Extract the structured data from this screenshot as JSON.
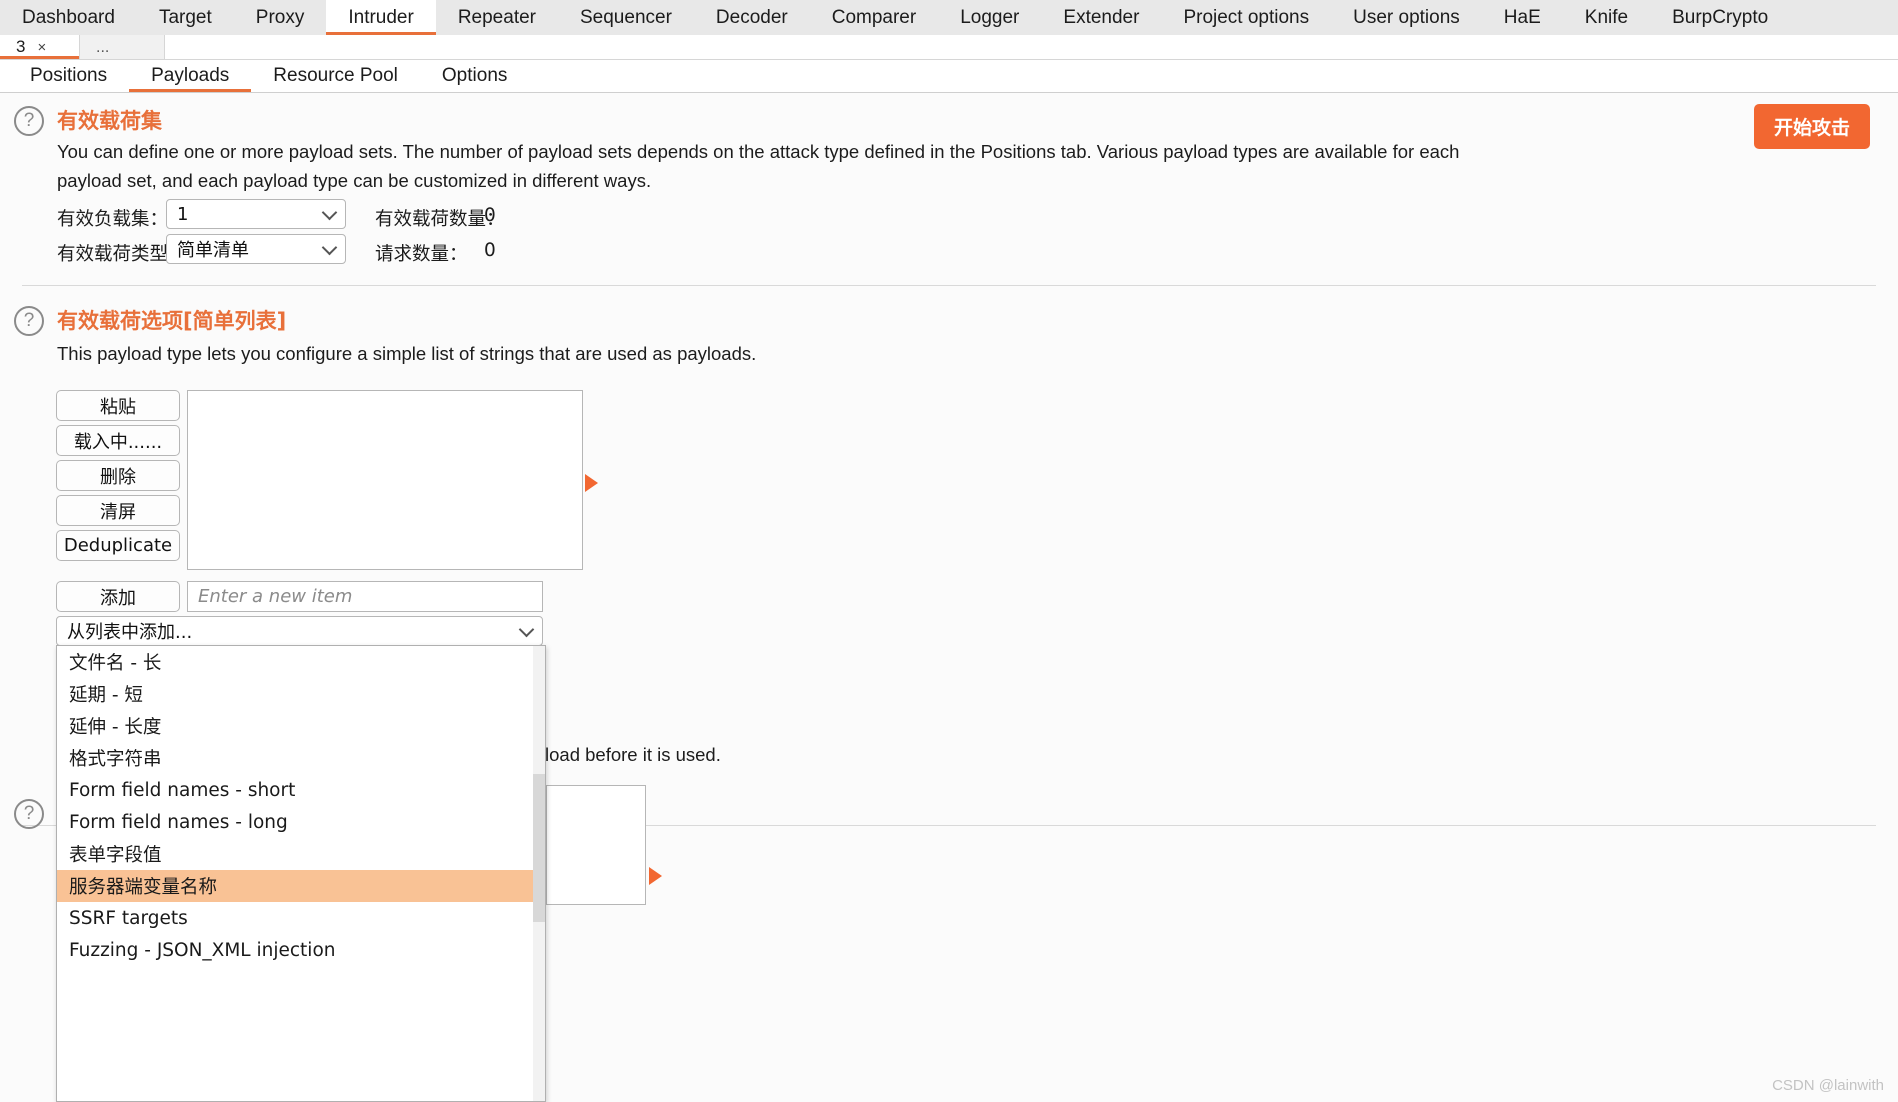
{
  "window": {
    "top_tabs": [
      {
        "label": "Dashboard",
        "active": false
      },
      {
        "label": "Target",
        "active": false
      },
      {
        "label": "Proxy",
        "active": false
      },
      {
        "label": "Intruder",
        "active": true
      },
      {
        "label": "Repeater",
        "active": false
      },
      {
        "label": "Sequencer",
        "active": false
      },
      {
        "label": "Decoder",
        "active": false
      },
      {
        "label": "Comparer",
        "active": false
      },
      {
        "label": "Logger",
        "active": false
      },
      {
        "label": "Extender",
        "active": false
      },
      {
        "label": "Project options",
        "active": false
      },
      {
        "label": "User options",
        "active": false
      },
      {
        "label": "HaE",
        "active": false
      },
      {
        "label": "Knife",
        "active": false
      },
      {
        "label": "BurpCrypto",
        "active": false
      }
    ],
    "accent_color": "#e8703a"
  },
  "attack_tabs": {
    "items": [
      {
        "label": "3",
        "close": "×"
      }
    ],
    "more_label": "..."
  },
  "sub_tabs": [
    {
      "label": "Positions",
      "active": false
    },
    {
      "label": "Payloads",
      "active": true
    },
    {
      "label": "Resource Pool",
      "active": false
    },
    {
      "label": "Options",
      "active": false
    }
  ],
  "start_attack": {
    "label": "开始攻击",
    "color": "#f26731"
  },
  "payload_sets": {
    "help_icon": "question-mark-icon",
    "title": "有效载荷集",
    "description": "You can define one or more payload sets. The number of payload sets depends on the attack type defined in the Positions tab. Various payload types are available for each payload set, and each payload type can be customized in different ways.",
    "set_label": "有效负载集：",
    "set_value": "1",
    "type_label": "有效载荷类型：",
    "type_value": "简单清单",
    "count_label": "有效载荷数量：",
    "count_value": "0",
    "requests_label": "请求数量：",
    "requests_value": "0"
  },
  "payload_options": {
    "help_icon": "question-mark-icon",
    "title": "有效载荷选项[简单列表]",
    "description": "This payload type lets you configure a simple list of strings that are used as payloads.",
    "buttons": [
      {
        "label": "粘贴"
      },
      {
        "label": "载入中......"
      },
      {
        "label": "删除"
      },
      {
        "label": "清屏"
      },
      {
        "label": "Deduplicate"
      }
    ],
    "list_items": [],
    "add_button": "添加",
    "add_placeholder": "Enter a new item",
    "add_value": "",
    "add_from_list_label": "从列表中添加..."
  },
  "dropdown": {
    "open": true,
    "highlight_color": "#f9c295",
    "items": [
      {
        "label": "文件名 - 长",
        "selected": false
      },
      {
        "label": "延期 - 短",
        "selected": false
      },
      {
        "label": "延伸 - 长度",
        "selected": false
      },
      {
        "label": "格式字符串",
        "selected": false
      },
      {
        "label": "Form field names - short",
        "selected": false
      },
      {
        "label": "Form field names - long",
        "selected": false
      },
      {
        "label": "表单字段值",
        "selected": false
      },
      {
        "label": "服务器端变量名称",
        "selected": true
      },
      {
        "label": "SSRF targets",
        "selected": false
      },
      {
        "label": "Fuzzing - JSON_XML injection",
        "selected": false
      }
    ]
  },
  "payload_processing": {
    "help_icon": "question-mark-icon",
    "description_tail": "load before it is used."
  },
  "watermark": "CSDN @lainwith"
}
